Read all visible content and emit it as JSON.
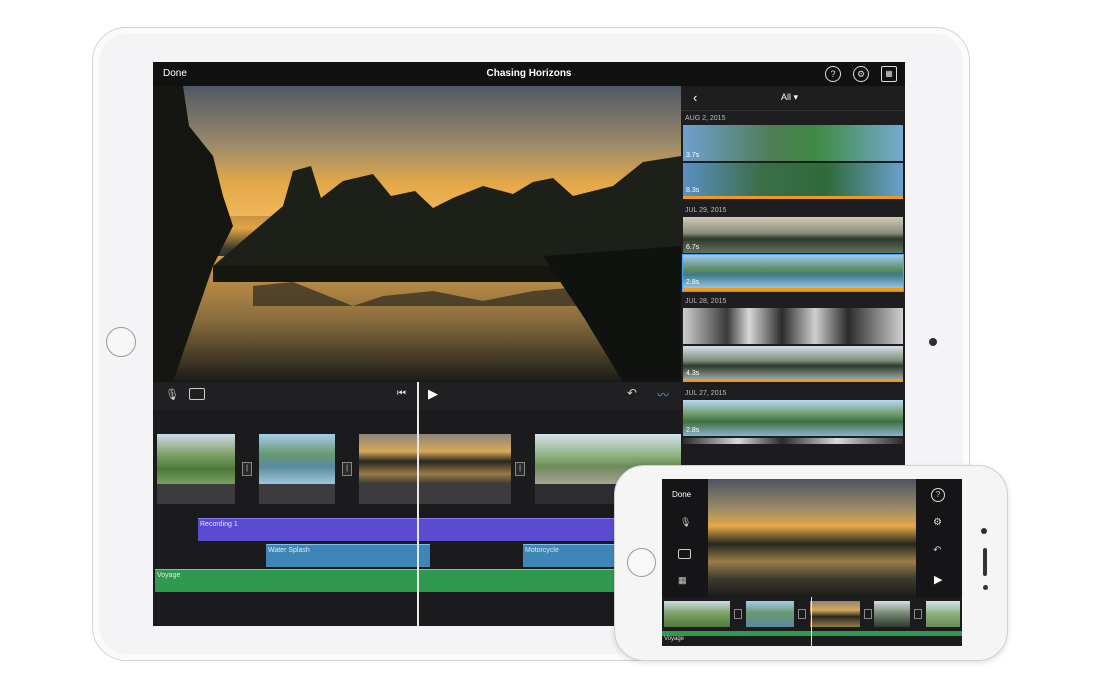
{
  "ipad": {
    "topbar": {
      "done_label": "Done",
      "title": "Chasing Horizons",
      "help_icon": "help-icon",
      "settings_icon": "gear-icon",
      "media_icon": "media-library-icon"
    },
    "library": {
      "back_icon": "chevron-left-icon",
      "filter_label": "All ▾",
      "sections": [
        {
          "date": "AUG 2, 2015",
          "clips": [
            {
              "duration": "3.7s"
            },
            {
              "duration": "8.3s"
            }
          ]
        },
        {
          "date": "JUL 29, 2015",
          "clips": [
            {
              "duration": "6.7s"
            },
            {
              "duration": "2.8s"
            }
          ]
        },
        {
          "date": "JUL 28, 2015",
          "clips": [
            {
              "duration": ""
            },
            {
              "duration": "4.3s"
            }
          ]
        },
        {
          "date": "JUL 27, 2015",
          "clips": [
            {
              "duration": "2.8s"
            },
            {
              "duration": ""
            }
          ]
        }
      ]
    },
    "transport": {
      "mic_icon": "microphone-icon",
      "camera_icon": "camera-icon",
      "rewind_icon": "skip-back-icon",
      "play_icon": "play-icon",
      "undo_icon": "undo-icon",
      "audio_icon": "waveform-icon"
    },
    "timeline": {
      "audio_tracks": [
        {
          "label": "Recording 1",
          "color": "#5a4bd1"
        },
        {
          "label": "Water Splash",
          "color": "#3f86b8"
        },
        {
          "label": "Motorcycle",
          "color": "#3f86b8"
        },
        {
          "label": "Voyage",
          "color": "#2f9a4f"
        }
      ]
    }
  },
  "iphone": {
    "done_label": "Done",
    "music_label": "Voyage"
  },
  "colors": {
    "screen_bg": "#1c1c1e",
    "accent_orange": "#f09a1c",
    "accent_blue": "#4aa3ff"
  }
}
